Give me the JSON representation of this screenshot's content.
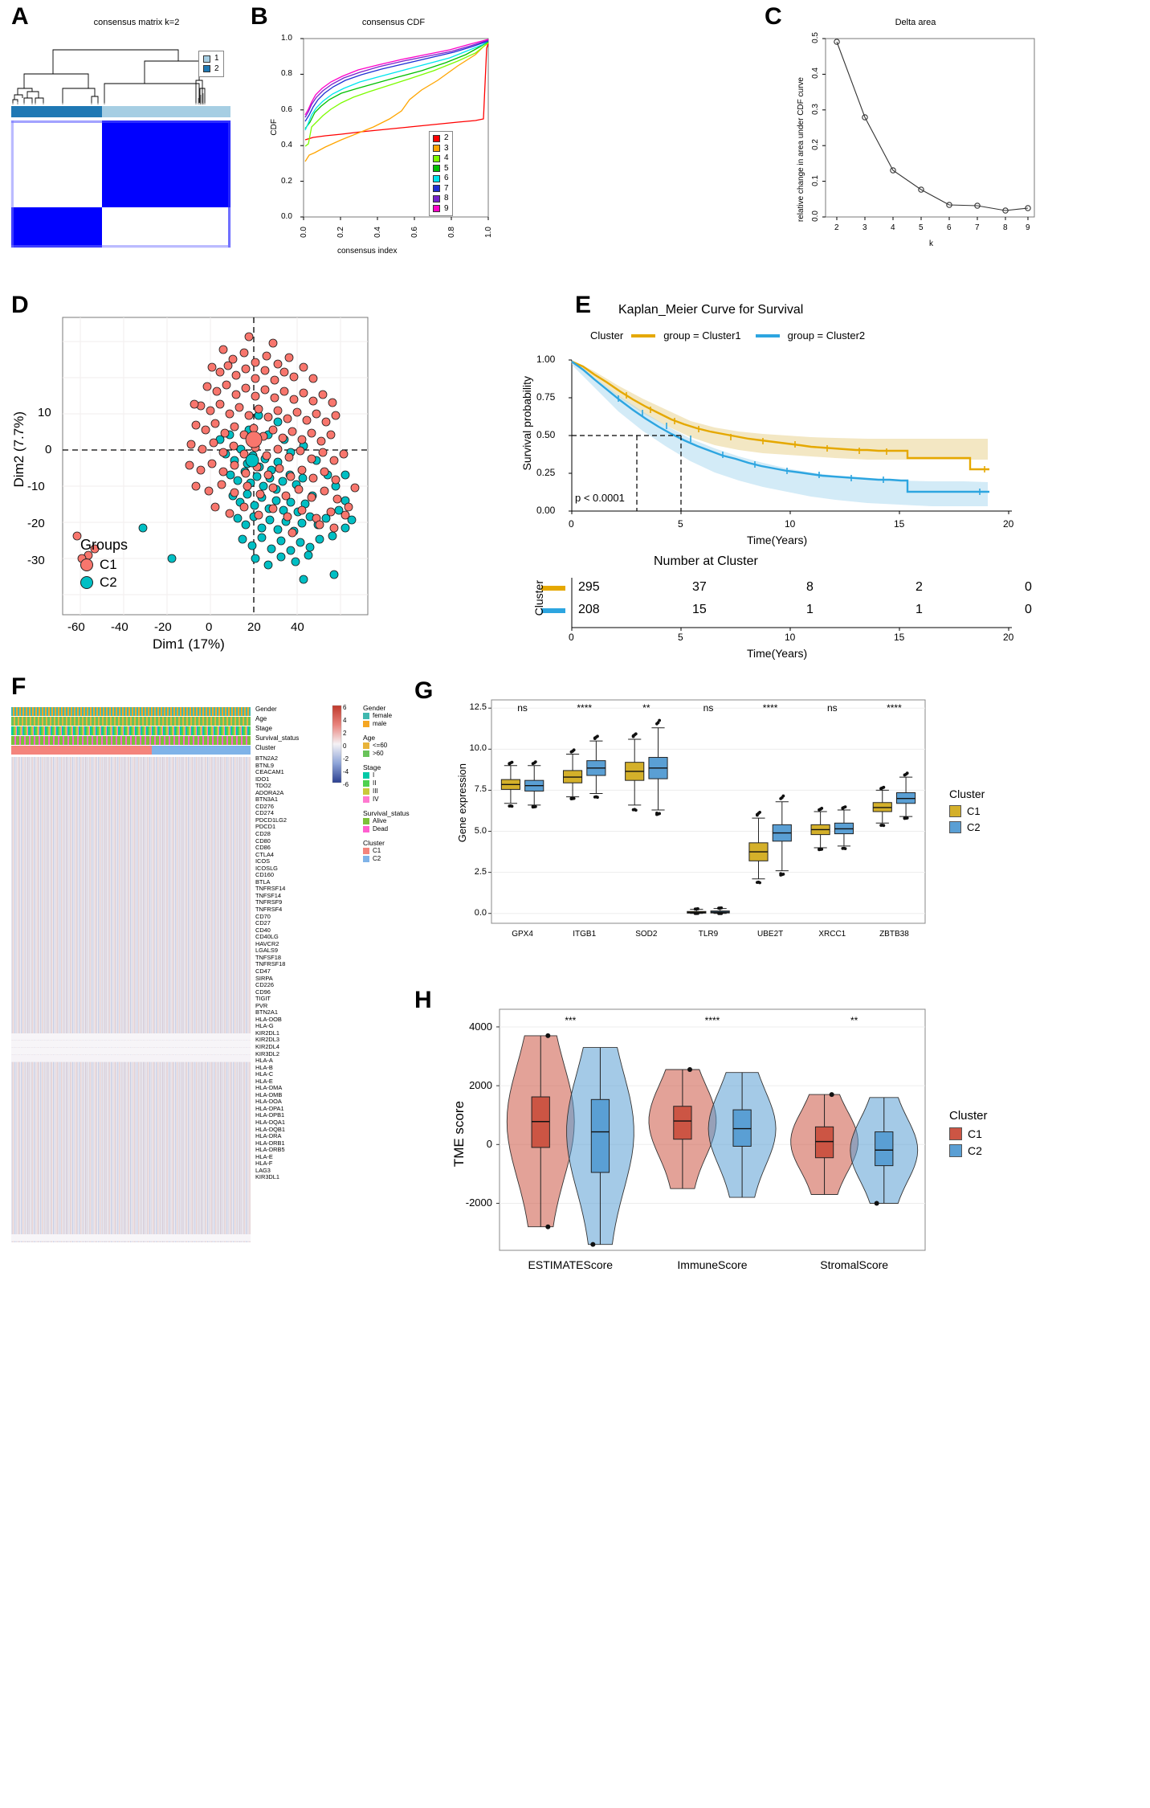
{
  "figure": {
    "panels": [
      "A",
      "B",
      "C",
      "D",
      "E",
      "F",
      "G",
      "H"
    ]
  },
  "panelA": {
    "label": "A",
    "title": "consensus matrix k=2",
    "legend": {
      "items": [
        {
          "label": "1",
          "color": "#a6cee3"
        },
        {
          "label": "2",
          "color": "#1f78b4"
        }
      ]
    },
    "matrix_color": "#0000ff"
  },
  "panelB": {
    "label": "B",
    "title": "consensus CDF",
    "xlabel": "consensus index",
    "ylabel": "CDF",
    "xticks": [
      "0.0",
      "0.2",
      "0.4",
      "0.6",
      "0.8",
      "1.0"
    ],
    "yticks": [
      "0.0",
      "0.2",
      "0.4",
      "0.6",
      "0.8",
      "1.0"
    ],
    "legend_items": [
      {
        "label": "2",
        "color": "#ff0000"
      },
      {
        "label": "3",
        "color": "#ffa500"
      },
      {
        "label": "4",
        "color": "#7cfc00"
      },
      {
        "label": "5",
        "color": "#00c000"
      },
      {
        "label": "6",
        "color": "#00e5ee"
      },
      {
        "label": "7",
        "color": "#1f2fd4"
      },
      {
        "label": "8",
        "color": "#7722cc"
      },
      {
        "label": "9",
        "color": "#ff00c8"
      }
    ]
  },
  "panelC": {
    "label": "C",
    "title": "Delta area",
    "xlabel": "k",
    "ylabel": "relative change in area under CDF curve",
    "xticks": [
      "2",
      "3",
      "4",
      "5",
      "6",
      "7",
      "8",
      "9"
    ],
    "yticks": [
      "0.0",
      "0.1",
      "0.2",
      "0.3",
      "0.4",
      "0.5"
    ]
  },
  "panelD": {
    "label": "D",
    "xlabel": "Dim1 (17%)",
    "ylabel": "Dim2 (7.7%)",
    "xticks": [
      "-60",
      "-40",
      "-20",
      "0",
      "20",
      "40"
    ],
    "yticks": [
      "-30",
      "-20",
      "-10",
      "0",
      "10"
    ],
    "legend_title": "Groups",
    "legend_items": [
      {
        "label": "C1",
        "color": "#f8766d"
      },
      {
        "label": "C2",
        "color": "#00bfc4"
      }
    ]
  },
  "panelE": {
    "label": "E",
    "title": "Kaplan_Meier Curve for Survival",
    "legend_title": "Cluster",
    "legend_items": [
      {
        "label": "group = Cluster1",
        "color": "#e5a800"
      },
      {
        "label": "group = Cluster2",
        "color": "#2da5e0"
      }
    ],
    "xlabel": "Time(Years)",
    "ylabel": "Survival probability",
    "xticks": [
      "0",
      "5",
      "10",
      "15",
      "20"
    ],
    "yticks": [
      "0.00",
      "0.25",
      "0.50",
      "0.75",
      "1.00"
    ],
    "pvalue": "p < 0.0001",
    "risk_title": "Number at Cluster",
    "risk_axis_label": "Cluster",
    "risk_xlabel": "Time(Years)",
    "risk_rows": [
      {
        "color": "#e5a800",
        "values": [
          "295",
          "37",
          "8",
          "2",
          "0"
        ]
      },
      {
        "color": "#2da5e0",
        "values": [
          "208",
          "15",
          "1",
          "1",
          "0"
        ]
      }
    ]
  },
  "panelF": {
    "label": "F",
    "colorbar_ticks": [
      "6",
      "4",
      "2",
      "0",
      "-2",
      "-4",
      "-6"
    ],
    "annotations": [
      {
        "name": "Gender",
        "items": [
          {
            "label": "female",
            "color": "#3fb8af"
          },
          {
            "label": "male",
            "color": "#f5a623"
          }
        ]
      },
      {
        "name": "Age",
        "items": [
          {
            "label": "<=60",
            "color": "#e8b33a"
          },
          {
            "label": ">60",
            "color": "#69c35a"
          }
        ]
      },
      {
        "name": "Stage",
        "items": [
          {
            "label": "I",
            "color": "#00c9a7"
          },
          {
            "label": "II",
            "color": "#4fd14f"
          },
          {
            "label": "III",
            "color": "#c9c93a"
          },
          {
            "label": "IV",
            "color": "#ff79d0"
          }
        ]
      },
      {
        "name": "Survival_status",
        "items": [
          {
            "label": "Alive",
            "color": "#7cc13a"
          },
          {
            "label": "Dead",
            "color": "#ff5fd0"
          }
        ]
      },
      {
        "name": "Cluster",
        "items": [
          {
            "label": "C1",
            "color": "#f4847c"
          },
          {
            "label": "C2",
            "color": "#7fb3e8"
          }
        ]
      }
    ],
    "row_track_names": [
      "Gender",
      "Age",
      "Stage",
      "Survival_status",
      "Cluster"
    ],
    "genes": [
      "BTN2A2",
      "BTNL9",
      "CEACAM1",
      "IDO1",
      "TDO2",
      "ADORA2A",
      "BTN3A1",
      "CD276",
      "CD274",
      "PDCD1LG2",
      "PDCD1",
      "CD28",
      "CD80",
      "CD86",
      "CTLA4",
      "ICOS",
      "ICOSLG",
      "CD160",
      "BTLA",
      "TNFRSF14",
      "TNFSF14",
      "TNFRSF9",
      "TNFRSF4",
      "CD70",
      "CD27",
      "CD40",
      "CD40LG",
      "HAVCR2",
      "LGALS9",
      "TNFSF18",
      "TNFRSF18",
      "CD47",
      "SIRPA",
      "CD226",
      "CD96",
      "TIGIT",
      "PVR",
      "BTN2A1",
      "HLA-DOB",
      "HLA-G",
      "KIR2DL1",
      "KIR2DL3",
      "KIR2DL4",
      "KIR3DL2",
      "HLA-A",
      "HLA-B",
      "HLA-C",
      "HLA-E",
      "HLA-DMA",
      "HLA-DMB",
      "HLA-DOA",
      "HLA-DPA1",
      "HLA-DPB1",
      "HLA-DQA1",
      "HLA-DQB1",
      "HLA-DRA",
      "HLA-DRB1",
      "HLA-DRB5",
      "HLA-E",
      "HLA-F",
      "LAG3",
      "KIR3DL1"
    ]
  },
  "panelG": {
    "label": "G",
    "ylabel": "Gene expression",
    "yticks": [
      "0.0",
      "2.5",
      "5.0",
      "7.5",
      "10.0",
      "12.5"
    ],
    "legend_title": "Cluster",
    "legend_items": [
      {
        "label": "C1",
        "color": "#d4b02a"
      },
      {
        "label": "C2",
        "color": "#5a9fd4"
      }
    ],
    "chart_data": {
      "type": "boxplot",
      "title": "",
      "xlabel": "",
      "ylabel": "Gene expression",
      "ylim": [
        -0.6,
        13.0
      ],
      "yticks": [
        0.0,
        2.5,
        5.0,
        7.5,
        10.0,
        12.5
      ],
      "categories": [
        "GPX4",
        "ITGB1",
        "SOD2",
        "TLR9",
        "UBE2T",
        "XRCC1",
        "ZBTB38"
      ],
      "significance": [
        "ns",
        "****",
        "**",
        "ns",
        "****",
        "ns",
        "****"
      ],
      "series": [
        {
          "name": "C1",
          "color": "#d4b02a",
          "boxes": [
            {
              "category": "GPX4",
              "min": 6.7,
              "q1": 7.55,
              "median": 7.85,
              "q3": 8.15,
              "max": 9.0
            },
            {
              "category": "ITGB1",
              "min": 7.1,
              "q1": 7.95,
              "median": 8.3,
              "q3": 8.7,
              "max": 9.7
            },
            {
              "category": "SOD2",
              "min": 6.6,
              "q1": 8.1,
              "median": 8.65,
              "q3": 9.2,
              "max": 10.6
            },
            {
              "category": "TLR9",
              "min": 0.0,
              "q1": 0.02,
              "median": 0.06,
              "q3": 0.12,
              "max": 0.25
            },
            {
              "category": "UBE2T",
              "min": 2.1,
              "q1": 3.2,
              "median": 3.75,
              "q3": 4.3,
              "max": 5.8
            },
            {
              "category": "XRCC1",
              "min": 4.0,
              "q1": 4.8,
              "median": 5.1,
              "q3": 5.4,
              "max": 6.2
            },
            {
              "category": "ZBTB38",
              "min": 5.5,
              "q1": 6.2,
              "median": 6.45,
              "q3": 6.75,
              "max": 7.5
            }
          ]
        },
        {
          "name": "C2",
          "color": "#5a9fd4",
          "boxes": [
            {
              "category": "GPX4",
              "min": 6.6,
              "q1": 7.45,
              "median": 7.78,
              "q3": 8.1,
              "max": 9.0
            },
            {
              "category": "ITGB1",
              "min": 7.3,
              "q1": 8.4,
              "median": 8.85,
              "q3": 9.3,
              "max": 10.5
            },
            {
              "category": "SOD2",
              "min": 6.3,
              "q1": 8.2,
              "median": 8.85,
              "q3": 9.5,
              "max": 11.3
            },
            {
              "category": "TLR9",
              "min": 0.0,
              "q1": 0.03,
              "median": 0.08,
              "q3": 0.15,
              "max": 0.3
            },
            {
              "category": "UBE2T",
              "min": 2.6,
              "q1": 4.4,
              "median": 4.9,
              "q3": 5.4,
              "max": 6.8
            },
            {
              "category": "XRCC1",
              "min": 4.1,
              "q1": 4.85,
              "median": 5.15,
              "q3": 5.5,
              "max": 6.3
            },
            {
              "category": "ZBTB38",
              "min": 5.9,
              "q1": 6.7,
              "median": 7.0,
              "q3": 7.35,
              "max": 8.3
            }
          ]
        }
      ]
    }
  },
  "panelH": {
    "label": "H",
    "ylabel": "TME score",
    "yticks": [
      "-2000",
      "0",
      "2000",
      "4000"
    ],
    "legend_title": "Cluster",
    "legend_items": [
      {
        "label": "C1",
        "color": "#cc5544"
      },
      {
        "label": "C2",
        "color": "#5a9fd4"
      }
    ],
    "chart_data": {
      "type": "violin",
      "title": "",
      "xlabel": "",
      "ylabel": "TME score",
      "ylim": [
        -3600,
        4600
      ],
      "yticks": [
        -2000,
        0,
        2000,
        4000
      ],
      "categories": [
        "ESTIMATEScore",
        "ImmuneScore",
        "StromalScore"
      ],
      "significance": [
        "***",
        "****",
        "**"
      ],
      "series": [
        {
          "name": "C1",
          "color": "#cc5544",
          "boxes": [
            {
              "category": "ESTIMATEScore",
              "min": -2800,
              "q1": -100,
              "median": 780,
              "q3": 1620,
              "max": 3700
            },
            {
              "category": "ImmuneScore",
              "min": -1500,
              "q1": 180,
              "median": 800,
              "q3": 1300,
              "max": 2550
            },
            {
              "category": "StromalScore",
              "min": -1700,
              "q1": -450,
              "median": 100,
              "q3": 600,
              "max": 1700
            }
          ]
        },
        {
          "name": "C2",
          "color": "#5a9fd4",
          "boxes": [
            {
              "category": "ESTIMATEScore",
              "min": -3400,
              "q1": -950,
              "median": 430,
              "q3": 1530,
              "max": 3300
            },
            {
              "category": "ImmuneScore",
              "min": -1800,
              "q1": -60,
              "median": 540,
              "q3": 1180,
              "max": 2450
            },
            {
              "category": "StromalScore",
              "min": -2000,
              "q1": -720,
              "median": -190,
              "q3": 430,
              "max": 1600
            }
          ]
        }
      ]
    }
  }
}
